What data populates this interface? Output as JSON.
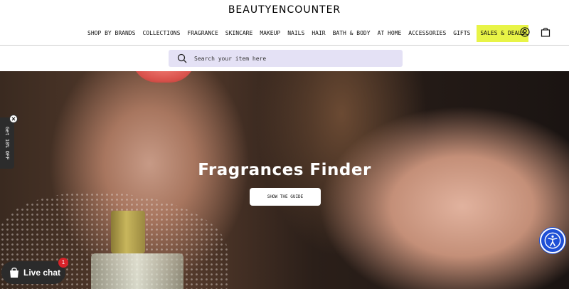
{
  "header": {
    "logo": "BEAUTYENCOUNTER",
    "nav": [
      "SHOP BY BRANDS",
      "COLLECTIONS",
      "FRAGRANCE",
      "SKINCARE",
      "MAKEUP",
      "NAILS",
      "HAIR",
      "BATH & BODY",
      "AT HOME",
      "ACCESSORIES",
      "GIFTS",
      "SALES & DEALS"
    ],
    "icons": {
      "account": "user-icon",
      "cart": "bag-icon"
    },
    "sale_highlight_color": "#e8f447"
  },
  "search": {
    "placeholder": "Search your item here"
  },
  "hero": {
    "title": "Fragrances Finder",
    "button": "SHOW THE GUIDE"
  },
  "promo": {
    "label": "Get 10% OFF"
  },
  "chat": {
    "label": "Live chat",
    "badge": "1"
  },
  "accessibility": {
    "icon": "accessibility-icon",
    "color": "#1e4fd6"
  }
}
